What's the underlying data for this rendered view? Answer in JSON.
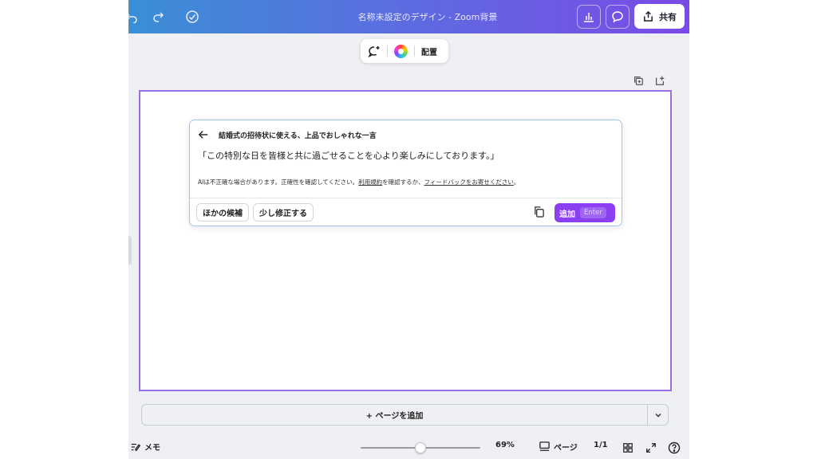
{
  "header": {
    "title": "名称未設定のデザイン - Zoom背景",
    "share_label": "共有"
  },
  "toolbar": {
    "arrange_label": "配置"
  },
  "ai_panel": {
    "prompt": "結婚式の招待状に使える、上品でおしゃれな一言",
    "result": "「この特別な日を皆様と共に過ごせることを心より楽しみにしております。」",
    "disclaimer_prefix": "AIは不正確な場合があります。正確性を確認してください。",
    "terms_link": "利用規約",
    "disclaimer_middle": "を確認するか、",
    "feedback_link": "フィードバックをお寄せください",
    "disclaimer_suffix": "。",
    "other_label": "ほかの候補",
    "refine_label": "少し修正する",
    "add_label": "追加",
    "add_shortcut": "Enter"
  },
  "bottom": {
    "add_page_label": "+ ページを追加",
    "notes_label": "メモ",
    "zoom_value": 69,
    "zoom_label": "69%",
    "pages_label": "ページ",
    "page_count": "1/1"
  },
  "colors": {
    "accent": "#8b3ff0",
    "page_border": "#9b6fe3",
    "panel_border": "#9ec7ef"
  }
}
